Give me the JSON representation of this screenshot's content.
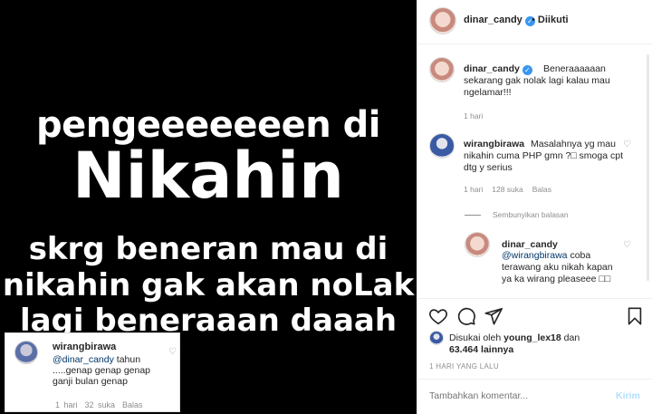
{
  "post_image": {
    "lines": [
      "pengeeeeeeen di",
      "Nikahin",
      "skrg beneran mau di",
      "nikahin gak akan noLak",
      "lagi beneraaan daaah"
    ]
  },
  "inset_comment": {
    "username": "wirangbirawa",
    "mention": "@dinar_candy",
    "text_after_mention": " tahun .....genap genap genap ganji bulan genap",
    "time": "1 hari",
    "likes": "32 suka",
    "reply": "Balas"
  },
  "header": {
    "username": "dinar_candy",
    "separator": "•",
    "follow_status": "Diikuti"
  },
  "comments": [
    {
      "username": "dinar_candy",
      "text": "Beneraaaaaan sekarang gak nolak lagi kalau mau ngelamar!!!",
      "time": "1 hari"
    },
    {
      "username": "wirangbirawa",
      "text": "Masalahnya yg mau nikahin cuma PHP gmn ?□ smoga cpt dtg y serius",
      "time": "1 hari",
      "likes": "128 suka",
      "reply": "Balas"
    }
  ],
  "hide_replies": "Sembunyikan balasan",
  "reply": {
    "username": "dinar_candy",
    "mention": "@wirangbirawa",
    "text_after_mention": " coba terawang aku nikah kapan ya ka wirang pleaseee □□"
  },
  "likes_info": {
    "prefix": "Disukai oleh",
    "user": "young_lex18",
    "middle": "dan",
    "count": "63.464 lainnya"
  },
  "post_time": "1 HARI YANG LALU",
  "add_comment": {
    "placeholder": "Tambahkan komentar...",
    "post_label": "Kirim"
  }
}
